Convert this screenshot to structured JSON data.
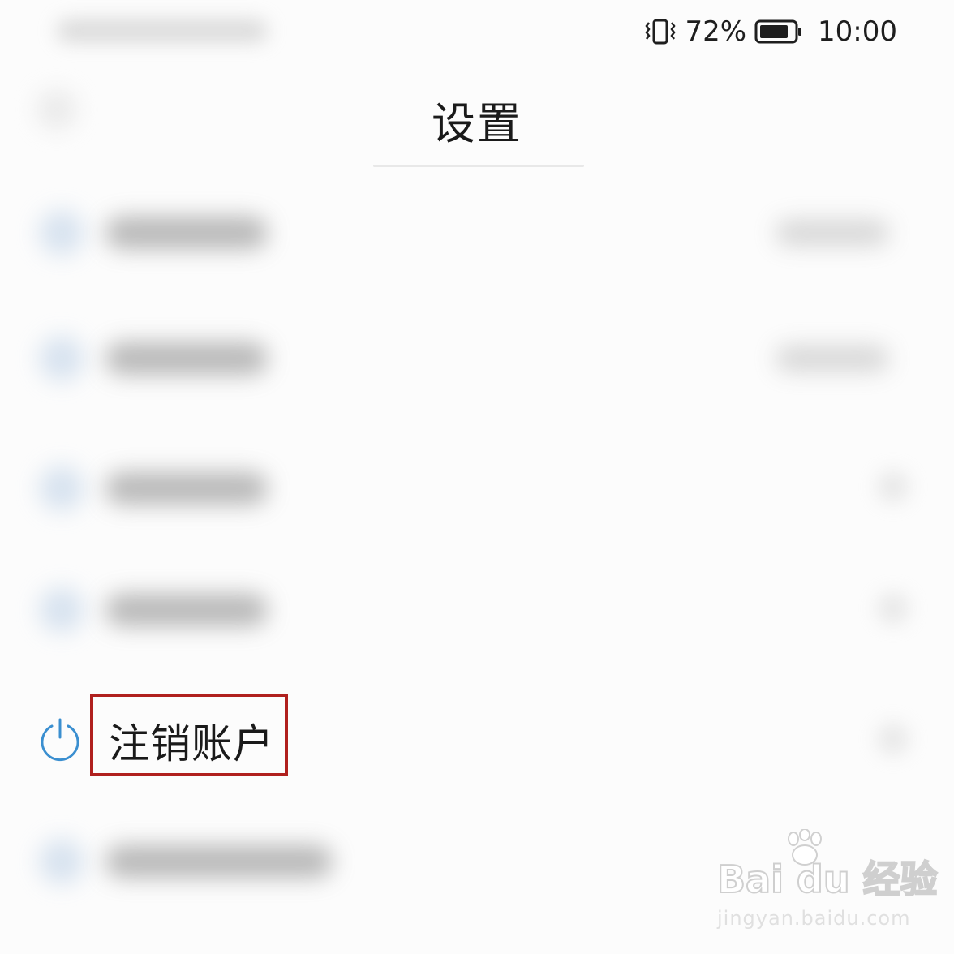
{
  "status_bar": {
    "vibrate_icon": "vibrate-icon",
    "battery_percent": "72%",
    "battery_icon": "battery-icon",
    "time": "10:00"
  },
  "header": {
    "title": "设置"
  },
  "menu": {
    "logout": {
      "label": "注销账户",
      "icon": "power-icon",
      "icon_color": "#3b8fd0",
      "highlight_color": "#b0201e"
    }
  },
  "watermark": {
    "brand": "Bai du 经验",
    "url": "jingyan.baidu.com"
  }
}
